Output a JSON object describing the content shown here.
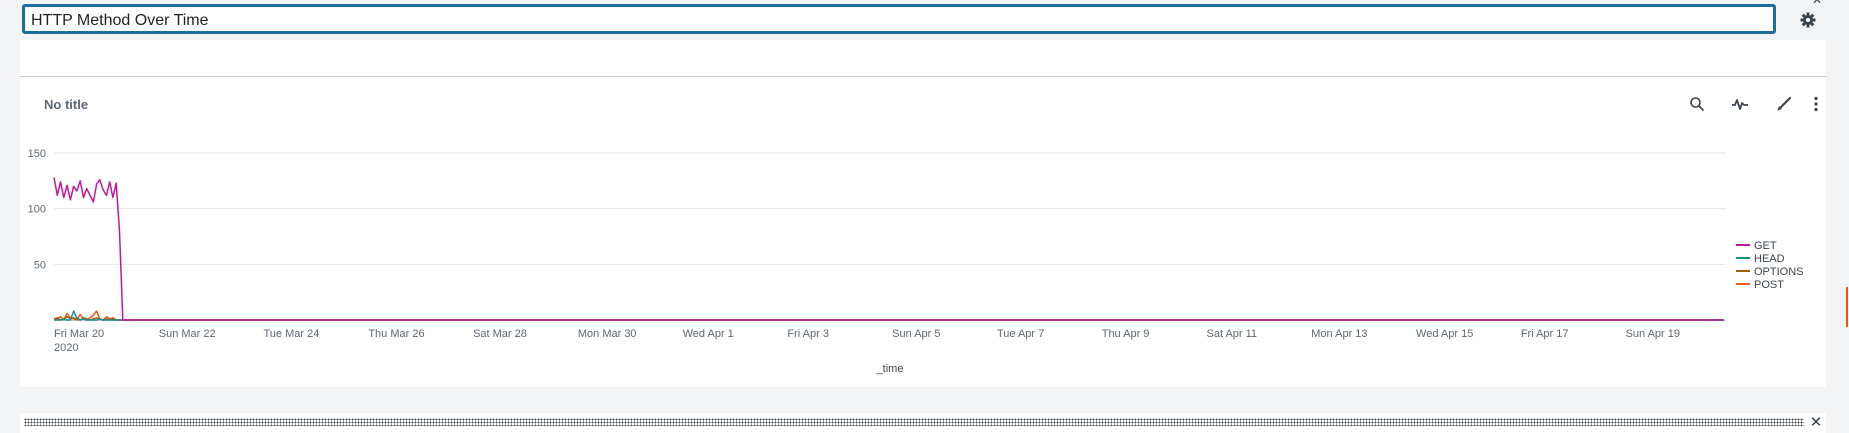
{
  "header": {
    "title_value": "HTTP Method Over Time",
    "settings_icon": "gear-icon",
    "close_icon": "close-icon"
  },
  "panel": {
    "title": "No title",
    "tools": [
      {
        "name": "search-icon"
      },
      {
        "name": "pulse-icon"
      },
      {
        "name": "brush-icon"
      },
      {
        "name": "kebab-menu-icon"
      }
    ]
  },
  "chart_data": {
    "type": "line",
    "xlabel": "_time",
    "ylabel": "",
    "ylim": [
      0,
      150
    ],
    "yticks": [
      50,
      100,
      150
    ],
    "grid": true,
    "legend_position": "right",
    "xticks": [
      {
        "date": "2020-03-20",
        "label": "Fri Mar 20",
        "sublabel": "2020"
      },
      {
        "date": "2020-03-22",
        "label": "Sun Mar 22"
      },
      {
        "date": "2020-03-24",
        "label": "Tue Mar 24"
      },
      {
        "date": "2020-03-26",
        "label": "Thu Mar 26"
      },
      {
        "date": "2020-03-28",
        "label": "Sat Mar 28"
      },
      {
        "date": "2020-03-30",
        "label": "Mon Mar 30"
      },
      {
        "date": "2020-04-01",
        "label": "Wed Apr 1"
      },
      {
        "date": "2020-04-03",
        "label": "Fri Apr 3"
      },
      {
        "date": "2020-04-05",
        "label": "Sun Apr 5"
      },
      {
        "date": "2020-04-07",
        "label": "Tue Apr 7"
      },
      {
        "date": "2020-04-09",
        "label": "Thu Apr 9"
      },
      {
        "date": "2020-04-11",
        "label": "Sat Apr 11"
      },
      {
        "date": "2020-04-13",
        "label": "Mon Apr 13"
      },
      {
        "date": "2020-04-15",
        "label": "Wed Apr 15"
      },
      {
        "date": "2020-04-17",
        "label": "Fri Apr 17"
      },
      {
        "date": "2020-04-19",
        "label": "Sun Apr 19"
      }
    ],
    "x": [
      "2020-03-20 00:00",
      "2020-03-20 01:30",
      "2020-03-20 03:00",
      "2020-03-20 04:30",
      "2020-03-20 06:00",
      "2020-03-20 07:30",
      "2020-03-20 09:00",
      "2020-03-20 10:30",
      "2020-03-20 12:00",
      "2020-03-20 13:30",
      "2020-03-20 15:00",
      "2020-03-20 16:30",
      "2020-03-20 18:00",
      "2020-03-20 19:30",
      "2020-03-20 21:00",
      "2020-03-20 22:30",
      "2020-03-21 00:00",
      "2020-03-21 01:30",
      "2020-03-21 03:00",
      "2020-03-21 04:30",
      "2020-03-21 06:00",
      "2020-03-21 07:30",
      "2020-03-21 09:00",
      "2020-03-21 10:30",
      "2020-03-21 12:00",
      "2020-03-21 13:30",
      "2020-03-21 15:00",
      "2020-03-21 16:30",
      "2020-03-21 18:00",
      "2020-03-21 19:30",
      "2020-04-20 21:00"
    ],
    "series": [
      {
        "name": "GET",
        "color": "#c1189b",
        "values": [
          128,
          112,
          124,
          110,
          121,
          108,
          120,
          116,
          125,
          110,
          118,
          112,
          106,
          122,
          126,
          117,
          112,
          124,
          110,
          123,
          80,
          0,
          0,
          0,
          0,
          0,
          0,
          0,
          0,
          0,
          0
        ]
      },
      {
        "name": "HEAD",
        "color": "#1b8f8d",
        "values": [
          0,
          0,
          0,
          1,
          0,
          0,
          8,
          2,
          0,
          1,
          0,
          0,
          0,
          0,
          1,
          0,
          0,
          0,
          0,
          0,
          0,
          0,
          0,
          0,
          0,
          0,
          0,
          0,
          0,
          0,
          0
        ]
      },
      {
        "name": "OPTIONS",
        "color": "#a65c00",
        "values": [
          1,
          2,
          0,
          1,
          3,
          1,
          2,
          1,
          0,
          2,
          1,
          0,
          1,
          2,
          1,
          0,
          1,
          0,
          1,
          0,
          0,
          0,
          0,
          0,
          0,
          0,
          0,
          0,
          0,
          0,
          0
        ]
      },
      {
        "name": "POST",
        "color": "#ec5b1c",
        "values": [
          0,
          1,
          3,
          0,
          6,
          2,
          1,
          0,
          5,
          1,
          0,
          2,
          4,
          8,
          1,
          0,
          3,
          1,
          2,
          0,
          0,
          0,
          0,
          0,
          0,
          0,
          0,
          0,
          0,
          0,
          0
        ]
      }
    ]
  }
}
